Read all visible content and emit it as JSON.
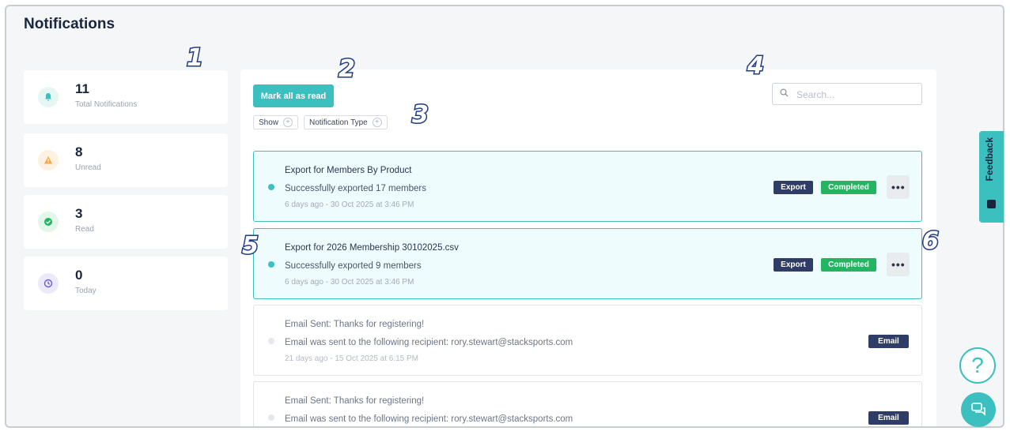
{
  "page": {
    "title": "Notifications"
  },
  "stats": [
    {
      "value": "11",
      "label": "Total Notifications",
      "icon": "bell-icon",
      "color": "#3bbfbf",
      "bg": "#e6f7f3"
    },
    {
      "value": "8",
      "label": "Unread",
      "icon": "warning-icon",
      "color": "#f5a742",
      "bg": "#fdf1e1"
    },
    {
      "value": "3",
      "label": "Read",
      "icon": "check-circle-icon",
      "color": "#22b562",
      "bg": "#e3f6ea"
    },
    {
      "value": "0",
      "label": "Today",
      "icon": "clock-icon",
      "color": "#6b5ccf",
      "bg": "#ece9fb"
    }
  ],
  "toolbar": {
    "mark_all_label": "Mark all as read",
    "search_placeholder": "Search...",
    "filters": [
      "Show",
      "Notification Type"
    ]
  },
  "notifications": [
    {
      "title": "Export for Members By Product",
      "message": "Successfully exported 17 members",
      "time": "6 days ago - 30 Oct 2025 at 3:46 PM",
      "status": "unread",
      "badges": [
        "Export",
        "Completed"
      ]
    },
    {
      "title": "Export for 2026 Membership 30102025.csv",
      "message": "Successfully exported 9 members",
      "time": "6 days ago - 30 Oct 2025 at 3:46 PM",
      "status": "unread",
      "badges": [
        "Export",
        "Completed"
      ]
    },
    {
      "title": "Email Sent: Thanks for registering!",
      "message": "Email was sent to the following recipient: rory.stewart@stacksports.com",
      "time": "21 days ago - 15 Oct 2025 at 6:15 PM",
      "status": "read",
      "badges": [
        "Email"
      ]
    },
    {
      "title": "Email Sent: Thanks for registering!",
      "message": "Email was sent to the following recipient: rory.stewart@stacksports.com",
      "time": "",
      "status": "read",
      "badges": [
        "Email"
      ]
    }
  ],
  "more_label": "•••",
  "feedback_label": "Feedback",
  "help_label": "?",
  "markers": [
    "1",
    "2",
    "3",
    "4",
    "5",
    "6"
  ],
  "colors": {
    "accent": "#3bbfbf",
    "navy": "#2f3d66",
    "success": "#22b562",
    "marker": "#1f3b8a"
  }
}
